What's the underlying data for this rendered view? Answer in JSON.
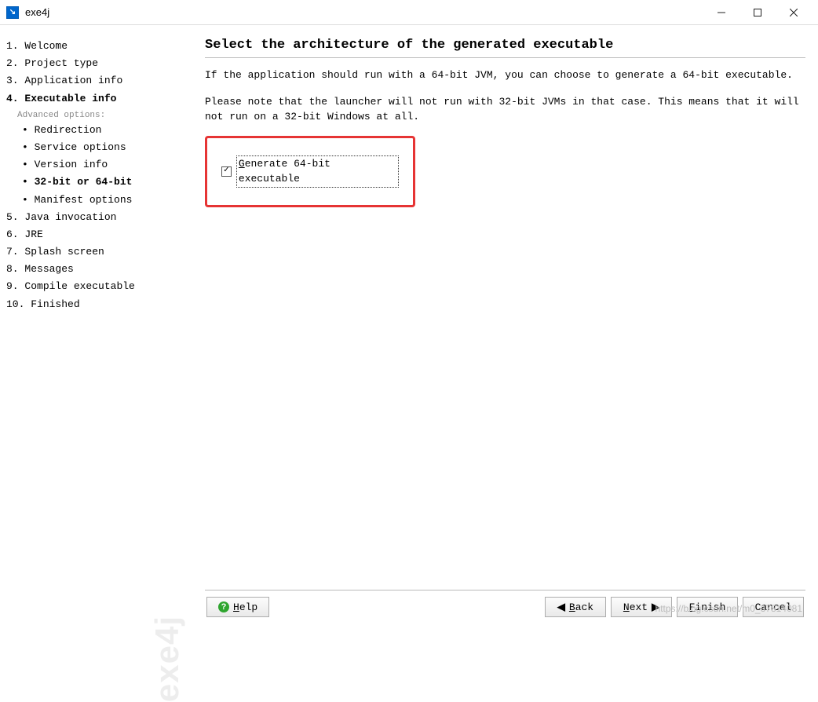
{
  "window": {
    "title": "exe4j"
  },
  "sidebar": {
    "steps": [
      {
        "num": "1.",
        "label": "Welcome"
      },
      {
        "num": "2.",
        "label": "Project type"
      },
      {
        "num": "3.",
        "label": "Application info"
      },
      {
        "num": "4.",
        "label": "Executable info",
        "bold": true
      },
      {
        "num": "5.",
        "label": "Java invocation"
      },
      {
        "num": "6.",
        "label": "JRE"
      },
      {
        "num": "7.",
        "label": "Splash screen"
      },
      {
        "num": "8.",
        "label": "Messages"
      },
      {
        "num": "9.",
        "label": "Compile executable"
      },
      {
        "num": "10.",
        "label": "Finished"
      }
    ],
    "advanced_label": "Advanced options:",
    "advanced": [
      {
        "label": "Redirection"
      },
      {
        "label": "Service options"
      },
      {
        "label": "Version info"
      },
      {
        "label": "32-bit or 64-bit",
        "bold": true
      },
      {
        "label": "Manifest options"
      }
    ],
    "brand": "exe4j"
  },
  "main": {
    "title": "Select the architecture of the generated executable",
    "p1": "If the application should run with a 64-bit JVM, you can choose to generate a 64-bit executable.",
    "p2": "Please note that the launcher will not run with 32-bit JVMs in that case. This means that it will not run on a 32-bit Windows at all.",
    "checkbox_label": "Generate 64-bit executable",
    "checkbox_checked": true
  },
  "buttons": {
    "help": "Help",
    "back": "Back",
    "next": "Next",
    "finish": "Finish",
    "cancel": "Cancel"
  },
  "watermark": "https://blog.csdn.net/m0_37814081"
}
